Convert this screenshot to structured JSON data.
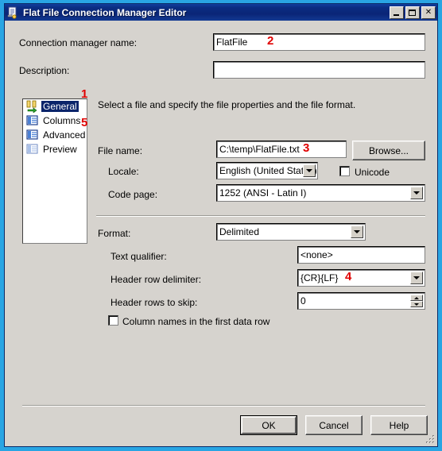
{
  "window": {
    "title": "Flat File Connection Manager Editor",
    "icon": "flat-file-connection-icon",
    "minimize_label": "",
    "maximize_label": "",
    "close_label": "✕"
  },
  "form": {
    "connection_manager_name_label": "Connection manager name:",
    "connection_manager_name_value": "FlatFile",
    "description_label": "Description:",
    "description_value": ""
  },
  "tree": {
    "items": [
      {
        "label": "General",
        "icon": "general-page-icon",
        "selected": true
      },
      {
        "label": "Columns",
        "icon": "columns-page-icon",
        "selected": false
      },
      {
        "label": "Advanced",
        "icon": "advanced-page-icon",
        "selected": false
      },
      {
        "label": "Preview",
        "icon": "preview-page-icon",
        "selected": false
      }
    ]
  },
  "general": {
    "instruction": "Select a file and specify the file properties and the file format.",
    "file_name_label": "File name:",
    "file_name_value": "C:\\temp\\FlatFile.txt",
    "browse_label": "Browse...",
    "locale_label": "Locale:",
    "locale_value": "English (United States)",
    "unicode_label": "Unicode",
    "unicode_checked": false,
    "code_page_label": "Code page:",
    "code_page_value": "1252  (ANSI - Latin I)"
  },
  "format": {
    "format_label": "Format:",
    "format_value": "Delimited",
    "text_qualifier_label": "Text qualifier:",
    "text_qualifier_value": "<none>",
    "header_row_delimiter_label": "Header row delimiter:",
    "header_row_delimiter_value": "{CR}{LF}",
    "header_rows_to_skip_label": "Header rows to skip:",
    "header_rows_to_skip_value": "0",
    "column_names_label": "Column names in the first data row",
    "column_names_checked": false
  },
  "footer": {
    "ok_label": "OK",
    "cancel_label": "Cancel",
    "help_label": "Help"
  },
  "annotations": [
    {
      "id": "annotation-1",
      "text": "1"
    },
    {
      "id": "annotation-2",
      "text": "2"
    },
    {
      "id": "annotation-3",
      "text": "3"
    },
    {
      "id": "annotation-4",
      "text": "4"
    },
    {
      "id": "annotation-5",
      "text": "5"
    }
  ],
  "colors": {
    "frame": "#29a5e3",
    "titlebar": "#0a2577",
    "dialog_face": "#d6d3ce",
    "selection": "#0a246a",
    "annotation": "#e00000"
  }
}
